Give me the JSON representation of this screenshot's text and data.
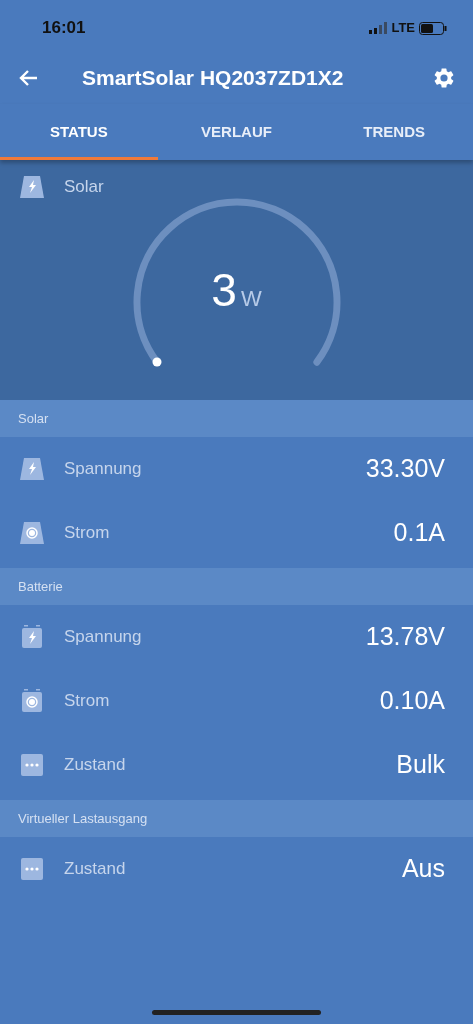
{
  "status_bar": {
    "time": "16:01",
    "network": "LTE"
  },
  "header": {
    "title": "SmartSolar HQ2037ZD1X2"
  },
  "tabs": [
    {
      "label": "STATUS",
      "selected": true
    },
    {
      "label": "VERLAUF",
      "selected": false
    },
    {
      "label": "TRENDS",
      "selected": false
    }
  ],
  "gauge": {
    "label": "Solar",
    "value": "3",
    "unit": "W"
  },
  "sections": [
    {
      "title": "Solar",
      "rows": [
        {
          "kind": "panel-bolt",
          "label": "Spannung",
          "value": "33.30V"
        },
        {
          "kind": "panel-current",
          "label": "Strom",
          "value": "0.1A"
        }
      ]
    },
    {
      "title": "Batterie",
      "rows": [
        {
          "kind": "battery-bolt",
          "label": "Spannung",
          "value": "13.78V"
        },
        {
          "kind": "battery-current",
          "label": "Strom",
          "value": "0.10A"
        },
        {
          "kind": "dots",
          "label": "Zustand",
          "value": "Bulk"
        }
      ]
    },
    {
      "title": "Virtueller Lastausgang",
      "rows": [
        {
          "kind": "dots",
          "label": "Zustand",
          "value": "Aus"
        }
      ]
    }
  ]
}
